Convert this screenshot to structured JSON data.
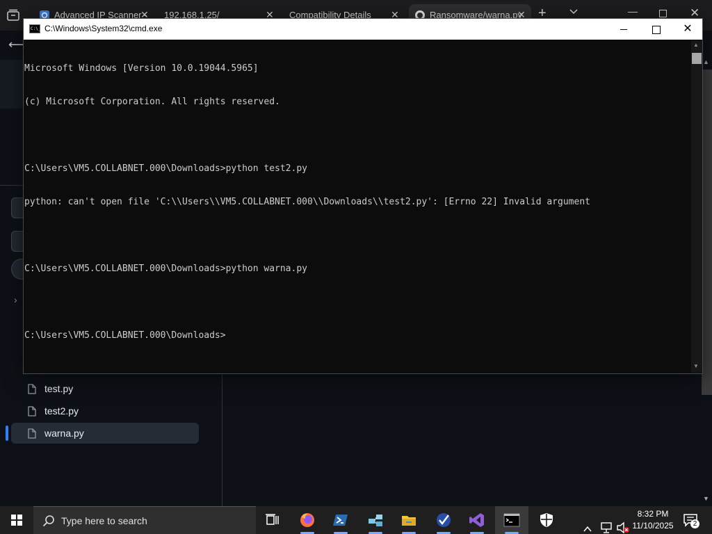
{
  "browser": {
    "tabs": [
      {
        "label": "Advanced IP Scanner -",
        "close": "✕"
      },
      {
        "label": "192.168.1.25/",
        "close": "✕"
      },
      {
        "label": "Compatibility Details",
        "close": "✕"
      },
      {
        "label": "Ransomware/warna.py",
        "close": "✕"
      }
    ],
    "new_tab": "+"
  },
  "file_tree": {
    "items": [
      {
        "name": "test.py"
      },
      {
        "name": "test2.py"
      },
      {
        "name": "warna.py",
        "selected": true
      }
    ]
  },
  "cmd": {
    "title": "C:\\Windows\\System32\\cmd.exe",
    "icon_text": "C:\\_",
    "lines": [
      "Microsoft Windows [Version 10.0.19044.5965]",
      "(c) Microsoft Corporation. All rights reserved.",
      "",
      "C:\\Users\\VM5.COLLABNET.000\\Downloads>python test2.py",
      "python: can't open file 'C:\\\\Users\\\\VM5.COLLABNET.000\\\\Downloads\\\\test2.py': [Errno 22] Invalid argument",
      "",
      "C:\\Users\\VM5.COLLABNET.000\\Downloads>python warna.py",
      "",
      "C:\\Users\\VM5.COLLABNET.000\\Downloads>"
    ]
  },
  "taskbar": {
    "search_placeholder": "Type here to search",
    "apps": [
      {
        "icon": "task-view-icon"
      },
      {
        "icon": "firefox-icon"
      },
      {
        "icon": "powershell-icon"
      },
      {
        "icon": "network-tool-icon"
      },
      {
        "icon": "file-explorer-icon"
      },
      {
        "icon": "checkmark-app-icon"
      },
      {
        "icon": "visual-studio-icon"
      },
      {
        "icon": "command-prompt-icon",
        "active": true
      },
      {
        "icon": "security-shield-icon"
      }
    ],
    "time": "8:32 PM",
    "date": "11/10/2025",
    "notification_count": "2"
  },
  "colors": {
    "console_bg": "#0c0c0c",
    "console_text": "#cccccc",
    "taskbar_bg": "#1f1f1f",
    "accent": "#2f81f7"
  }
}
